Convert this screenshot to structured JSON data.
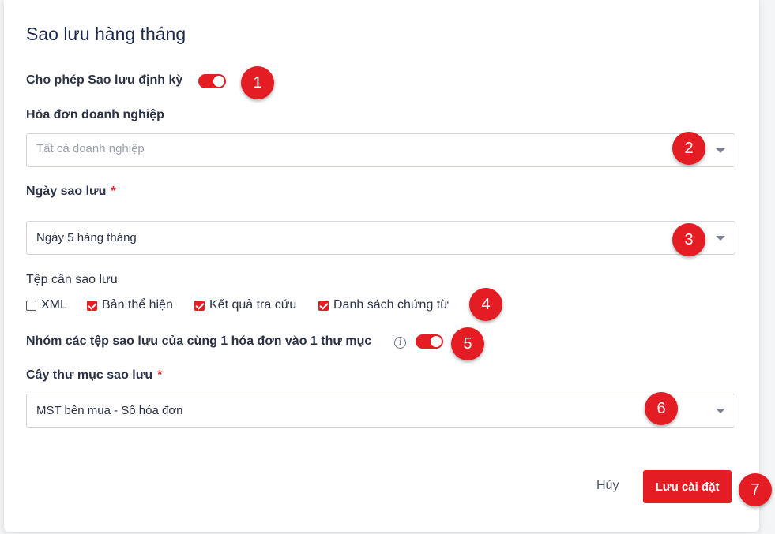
{
  "dialog": {
    "title": "Sao lưu hàng tháng",
    "enable_backup": {
      "label": "Cho phép Sao lưu định kỳ",
      "on": true
    },
    "invoice_company": {
      "label": "Hóa đơn doanh nghiệp",
      "placeholder": "Tất cả doanh nghiệp",
      "value": ""
    },
    "backup_day": {
      "label": "Ngày sao lưu",
      "required_mark": "*",
      "value": "Ngày 5 hàng tháng"
    },
    "files": {
      "label": "Tệp cần sao lưu",
      "options": [
        {
          "label": "XML",
          "checked": false
        },
        {
          "label": "Bản thể hiện",
          "checked": true
        },
        {
          "label": "Kết quả tra cứu",
          "checked": true
        },
        {
          "label": "Danh sách chứng từ",
          "checked": true
        }
      ]
    },
    "group_files": {
      "label": "Nhóm các tệp sao lưu của cùng 1 hóa đơn vào 1 thư mục",
      "info_icon": "info-circle-icon",
      "on": true
    },
    "folder_tree": {
      "label": "Cây thư mục sao lưu",
      "required_mark": "*",
      "value": "MST bên mua - Số hóa đơn"
    },
    "buttons": {
      "cancel": "Hủy",
      "save": "Lưu cài đặt"
    }
  },
  "annotations": [
    "1",
    "2",
    "3",
    "4",
    "5",
    "6",
    "7"
  ],
  "colors": {
    "accent": "#e41d25",
    "title": "#1e2a4a"
  }
}
